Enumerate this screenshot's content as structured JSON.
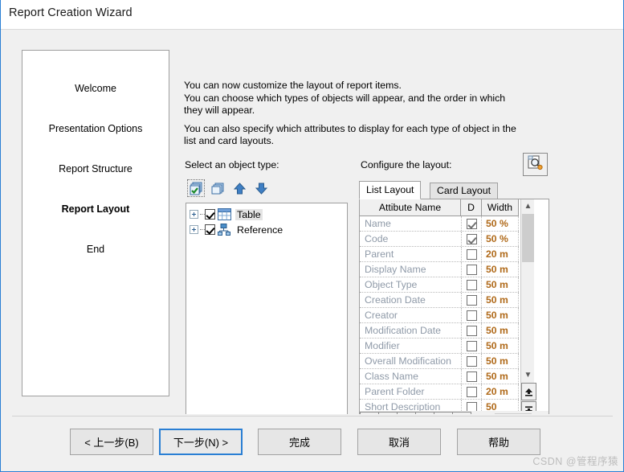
{
  "window": {
    "title": "Report Creation Wizard",
    "accent_color": "#2a7fd4",
    "background_color": "#f0f0f0"
  },
  "steps": [
    {
      "label": "Welcome",
      "current": false
    },
    {
      "label": "Presentation Options",
      "current": false
    },
    {
      "label": "Report Structure",
      "current": false
    },
    {
      "label": "Report Layout",
      "current": true
    },
    {
      "label": "End",
      "current": false
    }
  ],
  "instructions": {
    "line1": "You can now customize the layout of report items.",
    "line2": "You can choose which types of objects will appear, and the order in which",
    "line3": "they will appear.",
    "line4": "You can also specify which attributes to display for each type of object in the",
    "line5": "list and card layouts."
  },
  "object_type": {
    "label": "Select an object type:",
    "toolbar": [
      {
        "name": "select-all-icon",
        "focused": true
      },
      {
        "name": "copy-icon",
        "focused": false
      },
      {
        "name": "move-up-icon",
        "focused": false
      },
      {
        "name": "move-down-icon",
        "focused": false
      }
    ],
    "tree": [
      {
        "label": "Table",
        "checked": true,
        "expandable": true,
        "selected": true,
        "icon": "table-icon"
      },
      {
        "label": "Reference",
        "checked": true,
        "expandable": true,
        "selected": false,
        "icon": "reference-icon"
      }
    ]
  },
  "configure": {
    "label": "Configure the layout:",
    "preview_icon": "preview-icon",
    "tabs": [
      {
        "label": "List Layout",
        "active": true
      },
      {
        "label": "Card Layout",
        "active": false
      }
    ],
    "grid": {
      "columns": [
        "Attibute Name",
        "D",
        "Width"
      ],
      "rows": [
        {
          "name": "Name",
          "display": true,
          "width": "50 %"
        },
        {
          "name": "Code",
          "display": true,
          "width": "50 %"
        },
        {
          "name": "Parent",
          "display": false,
          "width": "20 m"
        },
        {
          "name": "Display Name",
          "display": false,
          "width": "50 m"
        },
        {
          "name": "Object Type",
          "display": false,
          "width": "50 m"
        },
        {
          "name": "Creation Date",
          "display": false,
          "width": "50 m"
        },
        {
          "name": "Creator",
          "display": false,
          "width": "50 m"
        },
        {
          "name": "Modification Date",
          "display": false,
          "width": "50 m"
        },
        {
          "name": "Modifier",
          "display": false,
          "width": "50 m"
        },
        {
          "name": "Overall Modification",
          "display": false,
          "width": "50 m"
        },
        {
          "name": "Class Name",
          "display": false,
          "width": "50 m"
        },
        {
          "name": "Parent Folder",
          "display": false,
          "width": "20 m"
        },
        {
          "name": "Short Description",
          "display": false,
          "width": "50"
        }
      ],
      "order_buttons": [
        "move-to-top-icon",
        "move-up-fast-icon",
        "move-up-icon",
        "move-down-icon",
        "move-down-fast-icon",
        "move-to-bottom-icon"
      ],
      "scroll": {
        "up_arrow": "chevron-up-icon",
        "down_arrow": "chevron-down-icon",
        "extra_top": "scroll-to-top-icon",
        "extra_bottom": "scroll-to-bottom-icon",
        "h_left": "chevron-left-icon",
        "h_right": "chevron-right-icon"
      }
    }
  },
  "footer": {
    "back": "< 上一步(B)",
    "next": "下一步(N) >",
    "finish": "完成",
    "cancel": "取消",
    "help": "帮助",
    "watermark": "CSDN @管程序猿"
  }
}
